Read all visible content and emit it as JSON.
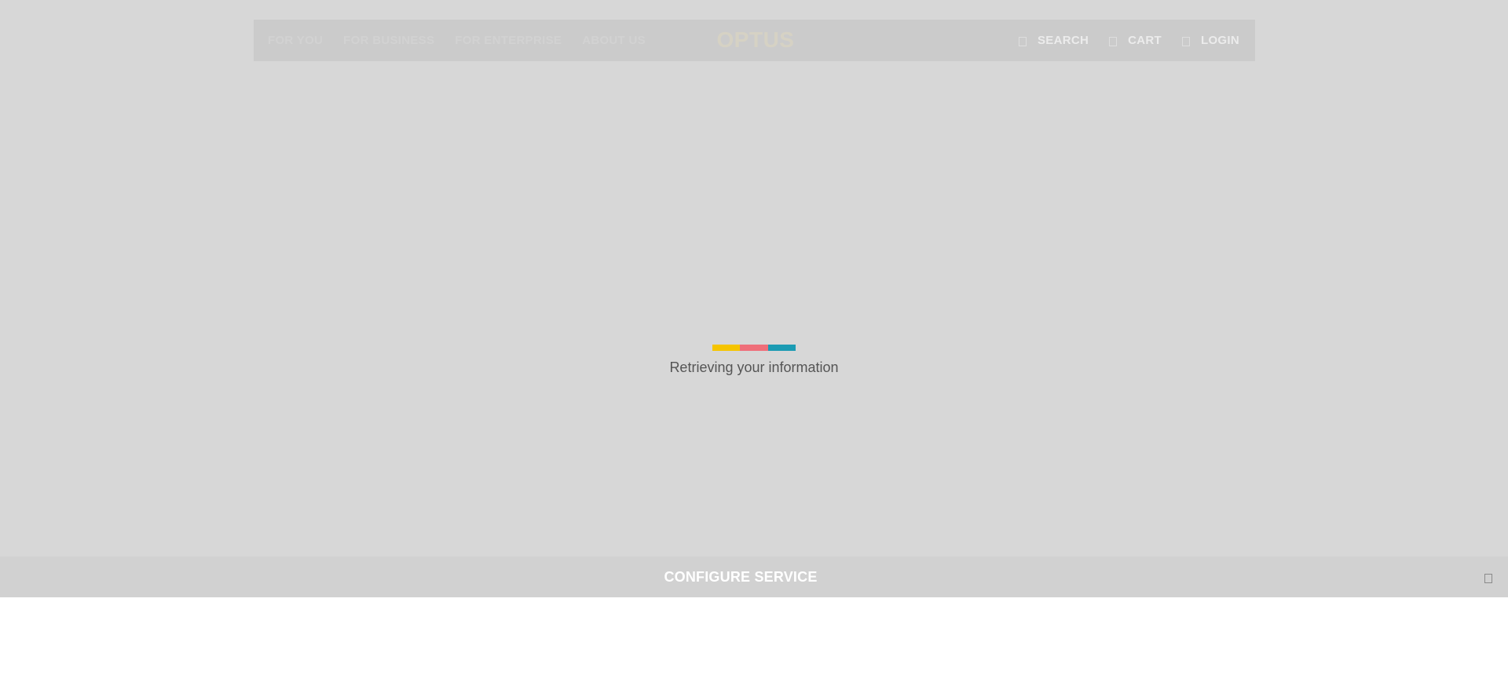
{
  "header": {
    "nav_links": [
      {
        "label": "FOR YOU"
      },
      {
        "label": "FOR BUSINESS"
      },
      {
        "label": "FOR ENTERPRISE"
      },
      {
        "label": "ABOUT US"
      }
    ],
    "logo_text": "OPTUS",
    "utility": {
      "search_label": "SEARCH",
      "search_icon": "search-icon",
      "cart_label": "CART",
      "cart_icon": "cart-icon",
      "login_label": "LOGIN",
      "login_icon": "user-icon"
    }
  },
  "loader": {
    "colors": [
      "#f5c400",
      "#ef6e79",
      "#1b9bb3"
    ],
    "message": "Retrieving your information"
  },
  "configure_bar": {
    "title": "CONFIGURE SERVICE",
    "close_icon": "close-icon"
  },
  "colors": {
    "overlay": "#d7d7d7",
    "header": "#cbcbcb",
    "config_bar": "#d1d1d1"
  }
}
